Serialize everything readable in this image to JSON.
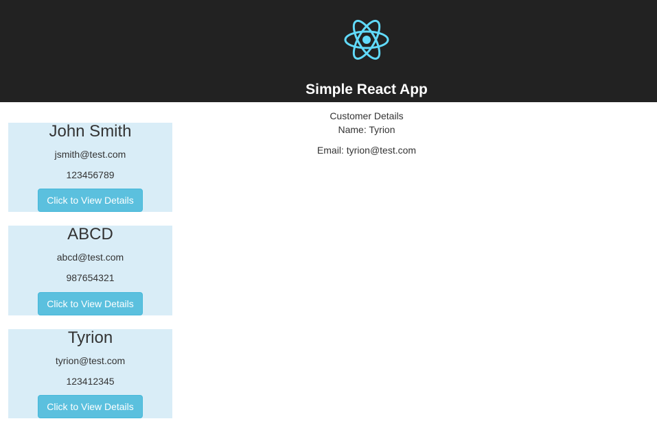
{
  "header": {
    "logo_icon": "react-atom-icon",
    "logo_color": "#61dafb",
    "title": "Simple React App",
    "background": "#222222"
  },
  "customers": [
    {
      "name": "John Smith",
      "email": "jsmith@test.com",
      "phone": "123456789",
      "button_label": "Click to View Details"
    },
    {
      "name": "ABCD",
      "email": "abcd@test.com",
      "phone": "987654321",
      "button_label": "Click to View Details"
    },
    {
      "name": "Tyrion",
      "email": "tyrion@test.com",
      "phone": "123412345",
      "button_label": "Click to View Details"
    }
  ],
  "details": {
    "heading": "Customer Details",
    "name_line": "Name: Tyrion",
    "email_line": "Email: tyrion@test.com"
  },
  "colors": {
    "card_background": "#d9edf7",
    "button_background": "#5bc0de",
    "text": "#333333"
  }
}
